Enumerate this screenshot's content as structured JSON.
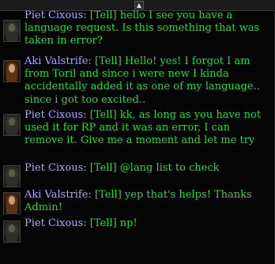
{
  "chat": {
    "scroll_arrow": "▲",
    "messages": [
      {
        "speaker": "Piet Cixous:",
        "tag": "[Tell]",
        "text": "hello I see you have a language request. Is this something that was taken in error?",
        "portrait": "piet-portrait"
      },
      {
        "speaker": "Aki Valstrife:",
        "tag": "[Tell]",
        "text": "Hello! yes! I forgot I am from Toril and since i were new I kinda accidentally added it as one of my language.. since i got too excited..",
        "portrait": "aki-portrait"
      },
      {
        "speaker": "Piet Cixous:",
        "tag": "[Tell]",
        "text": "kk, as long as you have not used it for RP and it was an error, I can remove it. Give me a moment and let me try",
        "portrait": "piet-portrait"
      },
      {
        "speaker": "Piet Cixous:",
        "tag": "[Tell]",
        "text": "@lang list to check",
        "portrait": "piet-portrait"
      },
      {
        "speaker": "Aki Valstrife:",
        "tag": "[Tell]",
        "text": "yep that's helps! Thanks Admin!",
        "portrait": "aki-portrait"
      },
      {
        "speaker": "Piet Cixous:",
        "tag": "[Tell]",
        "text": "np!",
        "portrait": "piet-portrait"
      }
    ]
  },
  "colors": {
    "background": "#050505",
    "speaker": "#a9a6ff",
    "message": "#2bd83f"
  }
}
